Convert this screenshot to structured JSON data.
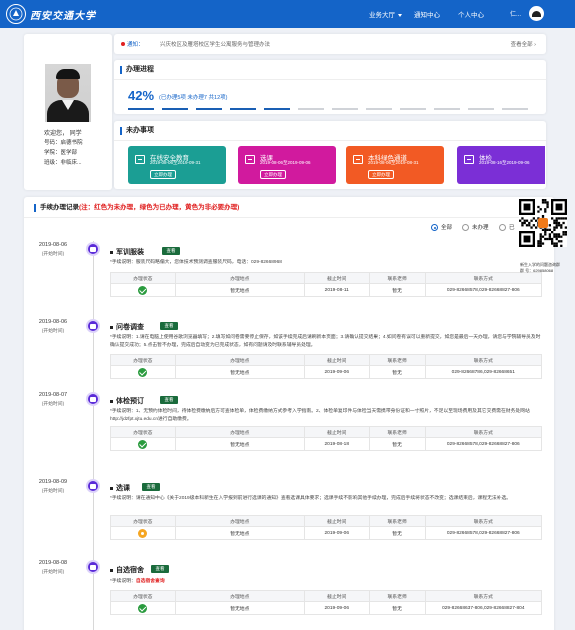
{
  "header": {
    "brand": "西安交通大学",
    "nav": [
      {
        "label": "业务大厅",
        "dropdown": true
      },
      {
        "label": "通知中心",
        "dropdown": false
      },
      {
        "label": "个人中心",
        "dropdown": false
      }
    ],
    "user_name": "仁..."
  },
  "profile": {
    "welcome": "欢迎您， 同学",
    "student_id": "号码：启德书院",
    "department": "学院：医学部",
    "major": "班级：非临床..."
  },
  "notice": {
    "label": "通知：",
    "message": "兴庆校区及雁塔校区学生公寓服务与管理办法",
    "more": "查看全部 ›"
  },
  "progress": {
    "title": "办理进程",
    "percent": "42%",
    "summary": "(已办理5项  未办理7  共12项)",
    "completed": 5,
    "total": 12,
    "done_color": "#1a5fb4",
    "todo_color": "#d0d3d8"
  },
  "pending": {
    "title": "未办事项",
    "items": [
      {
        "name": "在线安全教育",
        "date": "2019-08-06至2019-09-31",
        "button": "立即办理",
        "color": "#1b9e94"
      },
      {
        "name": "选课",
        "date": "2019-08-06至2019-09-06",
        "button": "立即办理",
        "color": "#d11a9e"
      },
      {
        "name": "本科绿色通道",
        "date": "2019-08-06至2019-08-31",
        "button": "立即办理",
        "color": "#f25a24"
      },
      {
        "name": "体检",
        "date": "2019-08-16至2019-09-06",
        "button": "",
        "color": "#7b2fd6"
      }
    ]
  },
  "records": {
    "title": "手续办理记录",
    "hint": "(注：红色为未办理，绿色为已办理，黄色为非必要办理)",
    "filters": [
      "全部",
      "未办理",
      "已"
    ],
    "view_label": "查看",
    "columns": [
      "办理状态",
      "办理地点",
      "截止时间",
      "联系老师",
      "联系方式"
    ],
    "items": [
      {
        "date": "2019-08-06",
        "sub": "(开始时间)",
        "title": "军训服装",
        "desc": "*手续说明：服装尺码略偏大，您体技术预测调查服装尺码，电话：029-82668968",
        "status": "done",
        "location": "暂无地点",
        "deadline": "2019-08-11",
        "teacher": "暂无",
        "contact": "029-82668578,029-82668827-806"
      },
      {
        "date": "2019-08-06",
        "sub": "(开始时间)",
        "title": "问卷调查",
        "desc": "*手续说明：1.请在电脑上使用谷歌浏览器填写；2.填写如问卷需要停止保存，如该手续完成后请刷新本页面；3.请确认提交结果；4.如问卷有误可以重新提交，如您是最后一天办理，请您与学院辅导员及时确认提交成功；5.点击暂不办理，完成后自动变为已完成状态，如有问题请及时联系辅导员处理。",
        "status": "done",
        "location": "暂无地点",
        "deadline": "2019-09-06",
        "teacher": "暂无",
        "contact": "029-82668786,029-82668651"
      },
      {
        "date": "2019-08-07",
        "sub": "(开始时间)",
        "title": "体检预订",
        "desc": "*手续说明：1、无预约体检时间，待体检费缴纳后方可查体检单，体检费缴纳方式参考入学指南。2、体检单复印件与体检当天需携带身份证和一寸照片，不足以至现场费用及其它交费需在财务处网站http://jdzfpt.xjtu.edu.cn进行自助缴费。",
        "status": "done",
        "location": "暂无地点",
        "deadline": "2019-08-18",
        "teacher": "暂无",
        "contact": "029-82668578,029-82668827-806"
      },
      {
        "date": "2019-08-09",
        "sub": "(开始时间)",
        "title": "选课",
        "desc": "*手续说明：请在通知中心《关于2019级本科新生在入学报到前进行选课的通知》查看选课具体要求；选课手续不影响其他手续办理，完成后手续将状态不改变；选课结束后，课程无法补选。",
        "status": "todo",
        "location": "暂无地点",
        "deadline": "2019-09-06",
        "teacher": "暂无",
        "contact": "029-82668578,029-82668827-806"
      },
      {
        "date": "2019-08-08",
        "sub": "(开始时间)",
        "title": "自选宿舍",
        "desc_prefix": "*手续说明：",
        "desc_red": "自选宿舍查询",
        "status": "done",
        "location": "暂无地点",
        "deadline": "2019-09-06",
        "teacher": "暂无",
        "contact": "029-82668637-806,029-82668827-804"
      }
    ]
  },
  "qr": {
    "title": "新生入学的问题咨询群",
    "group": "群 号：629858068"
  }
}
